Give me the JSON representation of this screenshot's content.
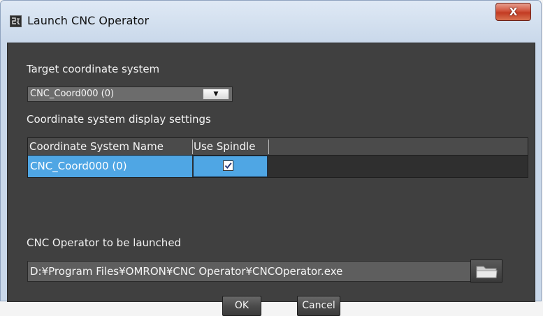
{
  "window": {
    "title": "Launch CNC Operator",
    "close_label": "X"
  },
  "target": {
    "label": "Target coordinate system",
    "selected": "CNC_Coord000 (0)"
  },
  "display_settings": {
    "label": "Coordinate system display settings",
    "columns": [
      "Coordinate System Name",
      "Use Spindle"
    ],
    "rows": [
      {
        "name": "CNC_Coord000 (0)",
        "use_spindle": true
      }
    ]
  },
  "operator": {
    "label": "CNC Operator to be launched",
    "path": "D:¥Program Files¥OMRON¥CNC Operator¥CNCOperator.exe"
  },
  "buttons": {
    "ok": "OK",
    "cancel": "Cancel"
  },
  "icons": {
    "app": "app-window-icon",
    "dropdown": "chevron-down-icon",
    "browse": "folder-icon",
    "check": "checkmark-icon"
  },
  "colors": {
    "client_bg": "#404040",
    "selection": "#4fa6e4",
    "close_button": "#c23a22"
  }
}
